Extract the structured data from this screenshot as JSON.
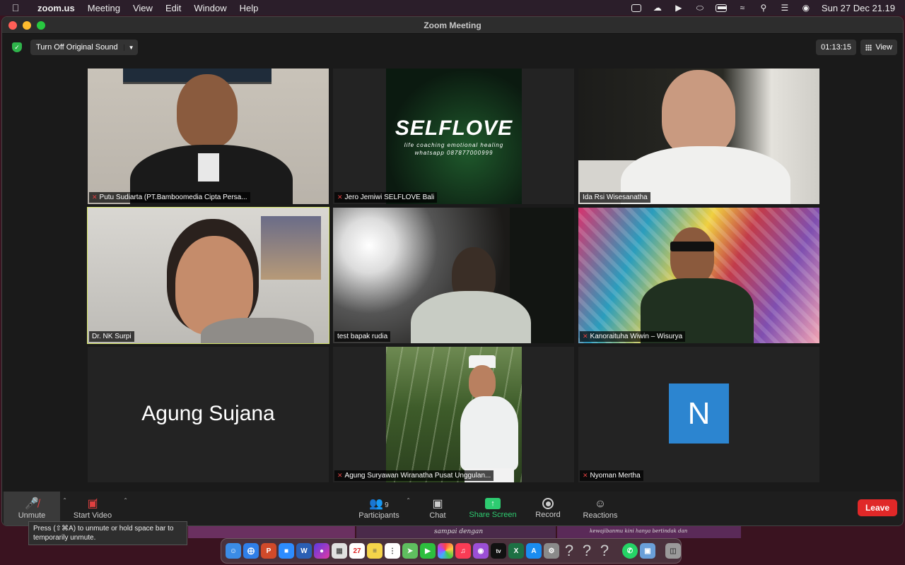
{
  "menubar": {
    "app": "zoom.us",
    "menus": [
      "Meeting",
      "View",
      "Edit",
      "Window",
      "Help"
    ],
    "datetime": "Sun 27 Dec  21.19"
  },
  "window": {
    "title": "Zoom Meeting",
    "original_sound_label": "Turn Off Original Sound",
    "timer": "01:13:15",
    "view_label": "View"
  },
  "tiles": [
    {
      "name": "Putu Sudiarta (PT.Bamboomedia Cipta Persa...",
      "muted": true,
      "kind": "video"
    },
    {
      "name": "Jero Jemiwi SELFLOVE Bali",
      "muted": true,
      "kind": "selflove",
      "card_title": "SELFLOVE",
      "card_line1": "life coaching emotional healing",
      "card_line2": "whatsapp 087877000999"
    },
    {
      "name": "Ida Rsi Wisesanatha",
      "muted": false,
      "kind": "video"
    },
    {
      "name": "Dr. NK Surpi",
      "muted": false,
      "kind": "video",
      "active": true
    },
    {
      "name": "test bapak rudia",
      "muted": false,
      "kind": "video"
    },
    {
      "name": "Kanoraituha Wiwin – Wisurya",
      "muted": true,
      "kind": "video"
    },
    {
      "name": "Agung Sujana",
      "muted": false,
      "kind": "name-only"
    },
    {
      "name": "Agung Suryawan Wiranatha Pusat Unggulan...",
      "muted": true,
      "kind": "photo"
    },
    {
      "name": "Nyoman Mertha",
      "muted": true,
      "kind": "avatar",
      "initial": "N"
    }
  ],
  "toolbar": {
    "unmute": "Unmute",
    "start_video": "Start Video",
    "participants": "Participants",
    "participant_count": "9",
    "chat": "Chat",
    "share_screen": "Share Screen",
    "record": "Record",
    "reactions": "Reactions",
    "leave": "Leave"
  },
  "tooltip": {
    "line1": "Press  (⇧⌘A) to unmute or hold space bar to",
    "line2": "temporarily unmute."
  },
  "background_text": {
    "left": "sampai dengan",
    "right": "kewajibanmu kini hanya bertindak dan"
  },
  "colors": {
    "active_speaker": "#d8e86b",
    "share_green": "#2ecc71",
    "leave_red": "#e02828",
    "avatar_blue": "#2c85d0"
  },
  "dock": {
    "date_icon_day": "27",
    "apps": [
      "finder-icon",
      "safari-icon",
      "powerpoint-icon",
      "zoom-icon",
      "word-icon",
      "siri-icon",
      "launchpad-icon",
      "calendar-icon",
      "notes-icon",
      "reminders-icon",
      "maps-icon",
      "facetime-icon",
      "photos-icon",
      "music-icon",
      "podcasts-icon",
      "tv-icon",
      "excel-icon",
      "app-store-icon",
      "system-preferences-icon",
      "unknown-app-icon",
      "unknown-app-icon",
      "unknown-app-icon",
      "whatsapp-icon",
      "preview-icon",
      "trash-icon"
    ]
  }
}
